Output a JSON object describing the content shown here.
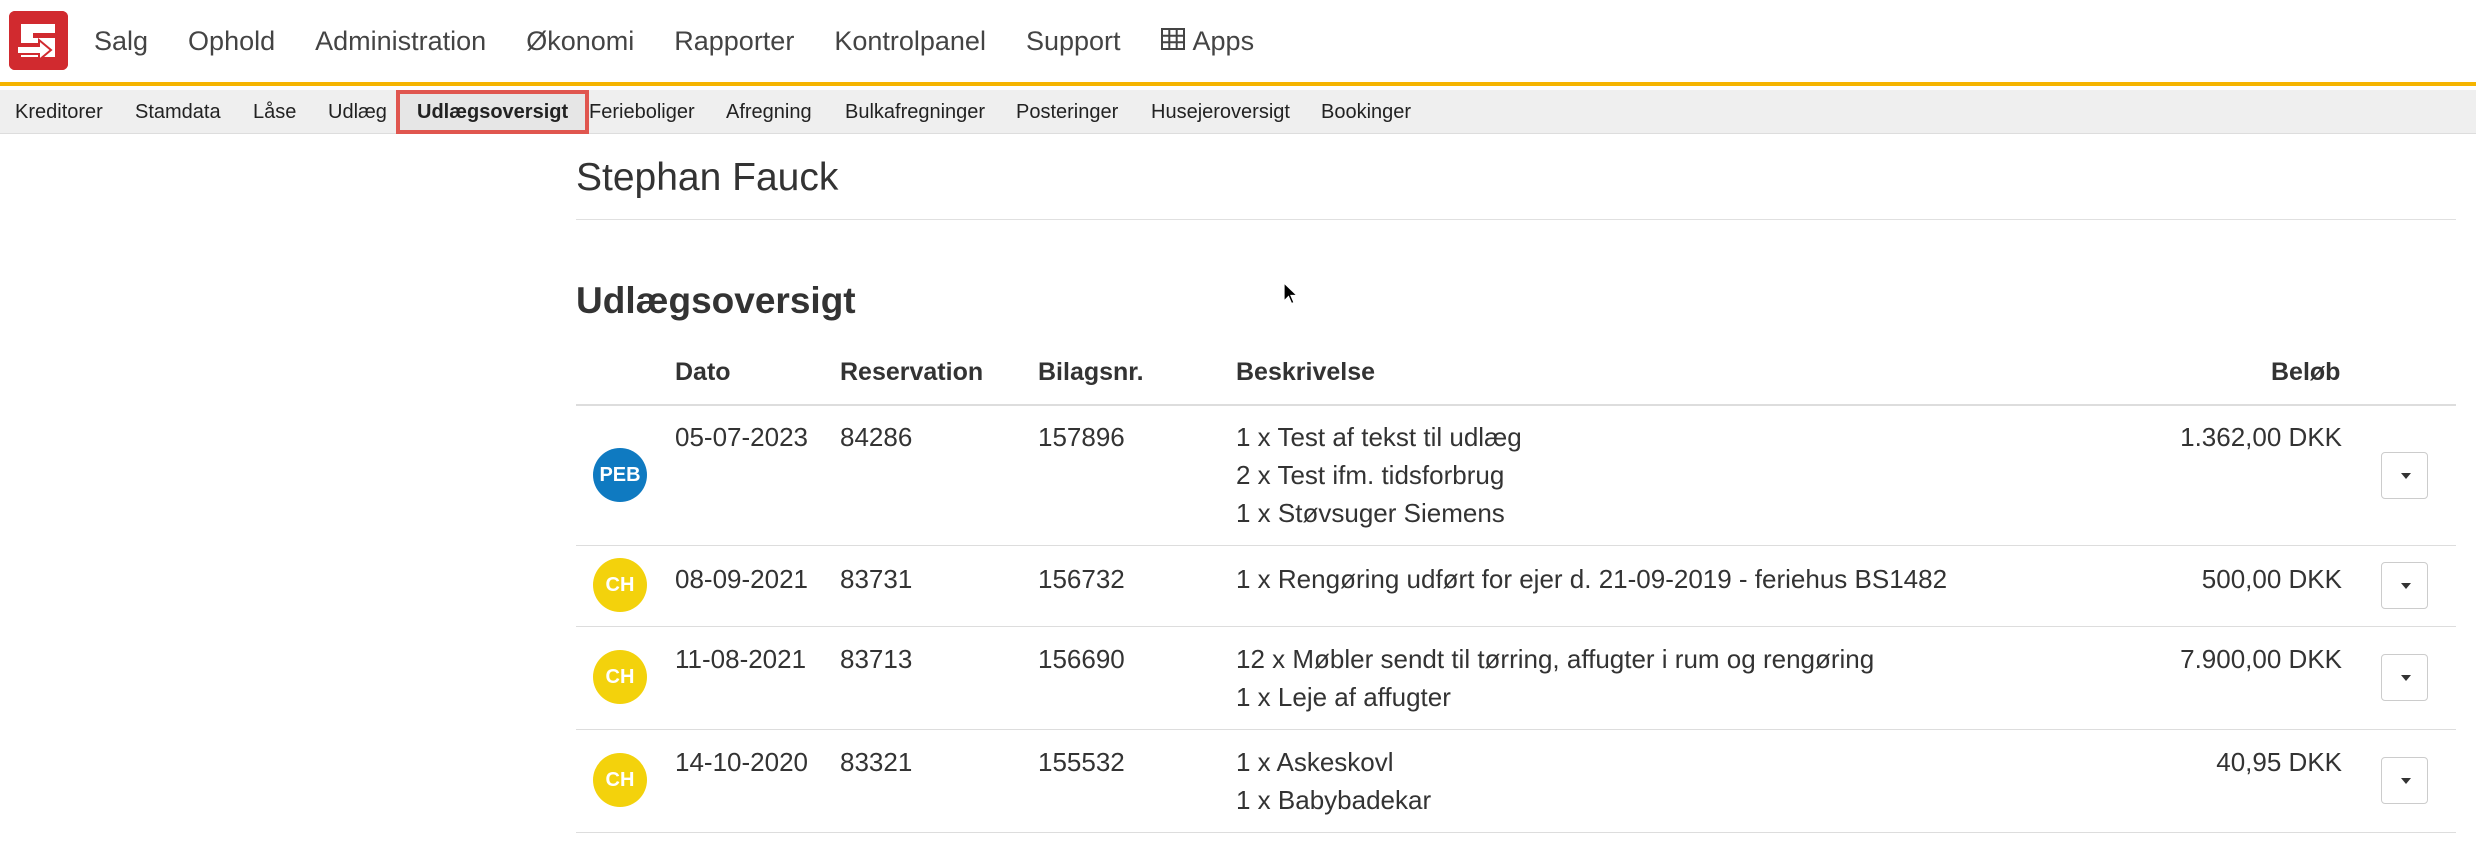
{
  "topnav": {
    "items": [
      "Salg",
      "Ophold",
      "Administration",
      "Økonomi",
      "Rapporter",
      "Kontrolpanel",
      "Support"
    ],
    "apps_label": "Apps",
    "apps_icon": "grid-icon",
    "brand_color": "#d12a2f",
    "accent_color": "#f5b400"
  },
  "subnav": {
    "items": [
      "Kreditorer",
      "Stamdata",
      "Låse",
      "Udlæg",
      "Udlægsoversigt",
      "Ferieboliger",
      "Afregning",
      "Bulkafregninger",
      "Posteringer",
      "Husejeroversigt",
      "Bookinger"
    ],
    "active": "Udlægsoversigt"
  },
  "page": {
    "owner_name": "Stephan Fauck",
    "section_title": "Udlægsoversigt"
  },
  "table": {
    "columns": {
      "dato": "Dato",
      "reservation": "Reservation",
      "bilagsnr": "Bilagsnr.",
      "beskrivelse": "Beskrivelse",
      "belob": "Beløb"
    },
    "rows": [
      {
        "initials": "PEB",
        "avatar_color": "#0f7ac1",
        "dato": "05-07-2023",
        "reservation": "84286",
        "bilagsnr": "157896",
        "beskrivelse": [
          "1 x Test af tekst til udlæg",
          "2 x Test ifm. tidsforbrug",
          "1 x Støvsuger Siemens"
        ],
        "belob": "1.362,00 DKK"
      },
      {
        "initials": "CH",
        "avatar_color": "#f3d20c",
        "dato": "08-09-2021",
        "reservation": "83731",
        "bilagsnr": "156732",
        "beskrivelse": [
          "1 x Rengøring udført for ejer d. 21-09-2019 - feriehus BS1482"
        ],
        "belob": "500,00 DKK"
      },
      {
        "initials": "CH",
        "avatar_color": "#f3d20c",
        "dato": "11-08-2021",
        "reservation": "83713",
        "bilagsnr": "156690",
        "beskrivelse": [
          "12 x Møbler sendt til tørring, affugter i rum og rengøring",
          "1 x Leje af affugter"
        ],
        "belob": "7.900,00 DKK"
      },
      {
        "initials": "CH",
        "avatar_color": "#f3d20c",
        "dato": "14-10-2020",
        "reservation": "83321",
        "bilagsnr": "155532",
        "beskrivelse": [
          "1 x Askeskovl",
          "1 x Babybadekar"
        ],
        "belob": "40,95 DKK"
      }
    ]
  }
}
